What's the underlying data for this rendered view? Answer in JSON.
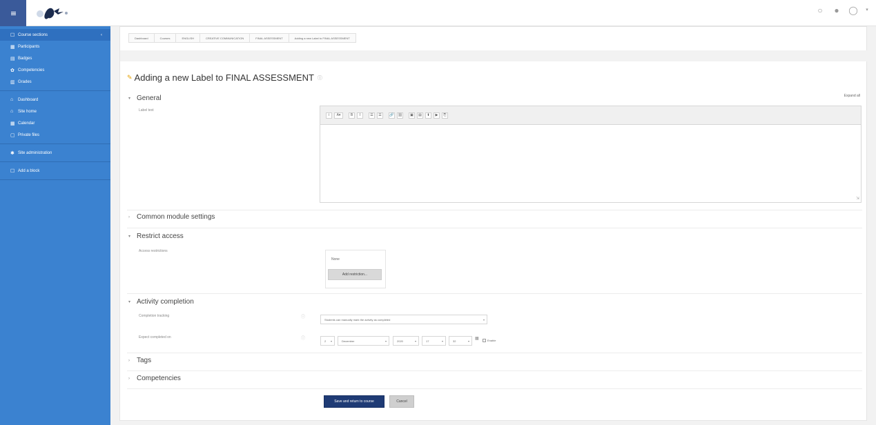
{
  "navbar": {
    "icons": [
      "chat-icon",
      "bell-icon",
      "user-avatar-icon"
    ],
    "caret": "▾"
  },
  "sidebar": {
    "groups": [
      [
        {
          "label": "Course sections",
          "icon": "☐",
          "active": true,
          "caret": "‹"
        },
        {
          "label": "Participants",
          "icon": "▦"
        },
        {
          "label": "Badges",
          "icon": "▤"
        },
        {
          "label": "Competencies",
          "icon": "✿"
        },
        {
          "label": "Grades",
          "icon": "▥"
        }
      ],
      [
        {
          "label": "Dashboard",
          "icon": "⌂"
        },
        {
          "label": "Site home",
          "icon": "⌂"
        },
        {
          "label": "Calendar",
          "icon": "▦"
        },
        {
          "label": "Private files",
          "icon": "▢"
        }
      ],
      [
        {
          "label": "Site administration",
          "icon": "✱"
        }
      ],
      [
        {
          "label": "Add a block",
          "icon": "☐"
        }
      ]
    ]
  },
  "breadcrumb": [
    "Dashboard",
    "Courses",
    "ENGLISH",
    "CREATIVE COMMUNICATION",
    "FINAL ASSESSMENT",
    "Adding a new Label to FINAL ASSESSMENT"
  ],
  "page": {
    "title": "Adding a new Label to FINAL ASSESSMENT",
    "expand_all": "Expand all"
  },
  "sections": {
    "general": "General",
    "common": "Common module settings",
    "restrict": "Restrict access",
    "completion": "Activity completion",
    "tags": "Tags",
    "competencies": "Competencies"
  },
  "form": {
    "label_text": "Label text",
    "access_restrictions": "Access restrictions",
    "none": "None",
    "add_restriction": "Add restriction...",
    "completion_tracking": "Completion tracking",
    "completion_value": "Students can manually mark the activity as completed",
    "expect_completed": "Expect completed on",
    "date": {
      "day": "2",
      "month": "December",
      "year": "2020",
      "hour": "17",
      "minute": "32"
    },
    "enable": "Enable"
  },
  "editor": {
    "toolbar": [
      "i",
      "A▾",
      "B",
      "I",
      "☰",
      "☰",
      "🔗",
      "⛓",
      "▣",
      "▤",
      "⬆",
      "▶",
      "⎘"
    ]
  },
  "buttons": {
    "save_return": "Save and return to course",
    "cancel": "Cancel"
  },
  "colors": {
    "sidebar": "#3b82d0",
    "primary_button": "#1f3b75",
    "pencil": "#e5a100"
  }
}
